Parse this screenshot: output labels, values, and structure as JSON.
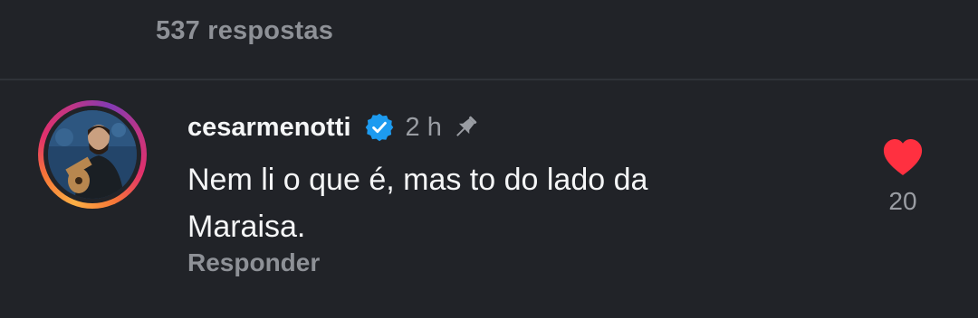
{
  "thread": {
    "replies_count": "537 respostas"
  },
  "comment": {
    "username": "cesarmenotti",
    "verified": true,
    "time": "2 h",
    "pinned": true,
    "text": "Nem li o que é, mas to do lado da Maraisa.",
    "reply_label": "Responder",
    "like_count": "20",
    "liked": true
  },
  "icons": {
    "verified": "verified-badge-icon",
    "pin": "pin-icon",
    "like": "heart-icon"
  },
  "colors": {
    "background": "#212328",
    "verified_blue": "#1d9bf0",
    "heart_red": "#ff3040",
    "muted_text": "#8e9197"
  }
}
